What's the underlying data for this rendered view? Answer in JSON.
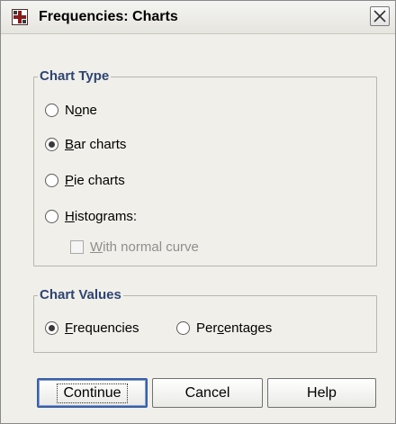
{
  "window": {
    "title": "Frequencies: Charts",
    "icon": "spss-dialog-icon",
    "close_icon": "close-icon"
  },
  "chart_type": {
    "legend": "Chart Type",
    "options": [
      {
        "prefix": "N",
        "accel": "o",
        "suffix": "ne",
        "selected": false
      },
      {
        "prefix": "",
        "accel": "B",
        "suffix": "ar charts",
        "selected": true
      },
      {
        "prefix": "",
        "accel": "P",
        "suffix": "ie charts",
        "selected": false
      },
      {
        "prefix": "",
        "accel": "H",
        "suffix": "istograms:",
        "selected": false
      }
    ],
    "normal_curve": {
      "prefix": "",
      "accel": "W",
      "suffix": "ith normal curve",
      "checked": false,
      "enabled": false
    }
  },
  "chart_values": {
    "legend": "Chart Values",
    "options": [
      {
        "prefix": "",
        "accel": "F",
        "suffix": "requencies",
        "selected": true
      },
      {
        "prefix": "Per",
        "accel": "c",
        "suffix": "entages",
        "selected": false
      }
    ]
  },
  "buttons": {
    "continue": "Continue",
    "cancel": "Cancel",
    "help": "Help"
  },
  "colors": {
    "group_legend": "#2e4472",
    "dialog_bg": "#f0efe9",
    "default_button_border": "#3b5fa5"
  }
}
